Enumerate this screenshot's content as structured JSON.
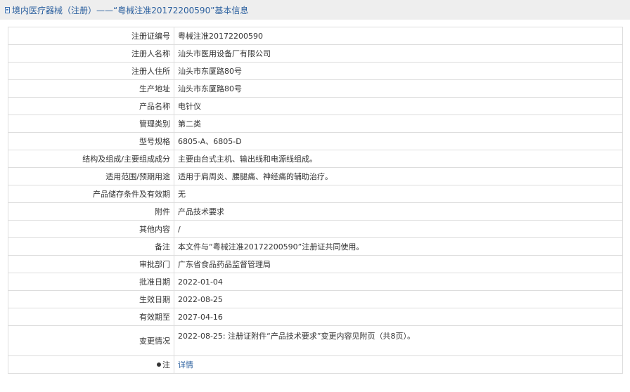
{
  "header": {
    "title": "境内医疗器械（注册）——“粤械注准20172200590”基本信息"
  },
  "rows": [
    {
      "label": "注册证编号",
      "value": "粤械注准20172200590"
    },
    {
      "label": "注册人名称",
      "value": "汕头市医用设备厂有限公司"
    },
    {
      "label": "注册人住所",
      "value": "汕头市东厦路80号"
    },
    {
      "label": "生产地址",
      "value": "汕头市东厦路80号"
    },
    {
      "label": "产品名称",
      "value": "电针仪"
    },
    {
      "label": "管理类别",
      "value": "第二类"
    },
    {
      "label": "型号规格",
      "value": "6805-A、6805-D"
    },
    {
      "label": "结构及组成/主要组成成分",
      "value": "主要由台式主机、输出线和电源线组成。"
    },
    {
      "label": "适用范围/预期用途",
      "value": "适用于肩周炎、腰腿痛、神经痛的辅助治疗。"
    },
    {
      "label": "产品储存条件及有效期",
      "value": "无"
    },
    {
      "label": "附件",
      "value": "产品技术要求"
    },
    {
      "label": "其他内容",
      "value": "/"
    },
    {
      "label": "备注",
      "value": "本文件与“粤械注准20172200590”注册证共同使用。"
    },
    {
      "label": "审批部门",
      "value": "广东省食品药品监督管理局"
    },
    {
      "label": "批准日期",
      "value": "2022-01-04"
    },
    {
      "label": "生效日期",
      "value": "2022-08-25"
    },
    {
      "label": "有效期至",
      "value": "2027-04-16"
    }
  ],
  "change_row": {
    "label": "变更情况",
    "value": "2022-08-25: 注册证附件“产品技术要求”变更内容见附页（共8页）。"
  },
  "note_row": {
    "label": "注",
    "icon": "pin-icon",
    "link": "详情"
  }
}
